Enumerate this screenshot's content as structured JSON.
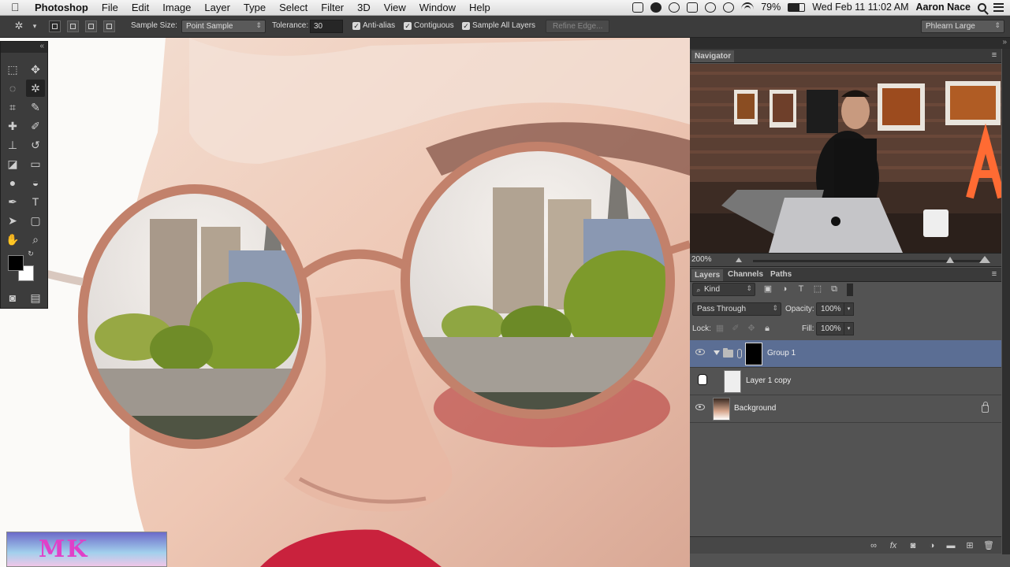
{
  "menubar": {
    "apple": "",
    "items": [
      "Photoshop",
      "File",
      "Edit",
      "Image",
      "Layer",
      "Type",
      "Select",
      "Filter",
      "3D",
      "View",
      "Window",
      "Help"
    ],
    "battery": "79%",
    "datetime": "Wed Feb 11  11:02 AM",
    "user": "Aaron Nace"
  },
  "options": {
    "sample_size_label": "Sample Size:",
    "sample_size_value": "Point Sample",
    "tolerance_label": "Tolerance:",
    "tolerance_value": "30",
    "anti_alias": "Anti-alias",
    "contiguous": "Contiguous",
    "sample_all_layers": "Sample All Layers",
    "refine_edge": "Refine Edge...",
    "workspace": "Phlearn Large"
  },
  "navigator": {
    "tab": "Navigator",
    "zoom": "200%"
  },
  "layers_panel": {
    "tabs": [
      "Layers",
      "Channels",
      "Paths"
    ],
    "filter_kind": "Kind",
    "blend_mode": "Pass Through",
    "opacity_label": "Opacity:",
    "opacity_value": "100%",
    "lock_label": "Lock:",
    "fill_label": "Fill:",
    "fill_value": "100%",
    "layers": [
      {
        "name": "Group 1",
        "selected": true
      },
      {
        "name": "Layer 1 copy",
        "selected": false
      },
      {
        "name": "Background",
        "selected": false
      }
    ]
  },
  "watermark": "MK",
  "colors": {
    "selected_layer": "#5b6e94",
    "panel_bg": "#535353",
    "toolbar_bg": "#3c3c3c"
  }
}
